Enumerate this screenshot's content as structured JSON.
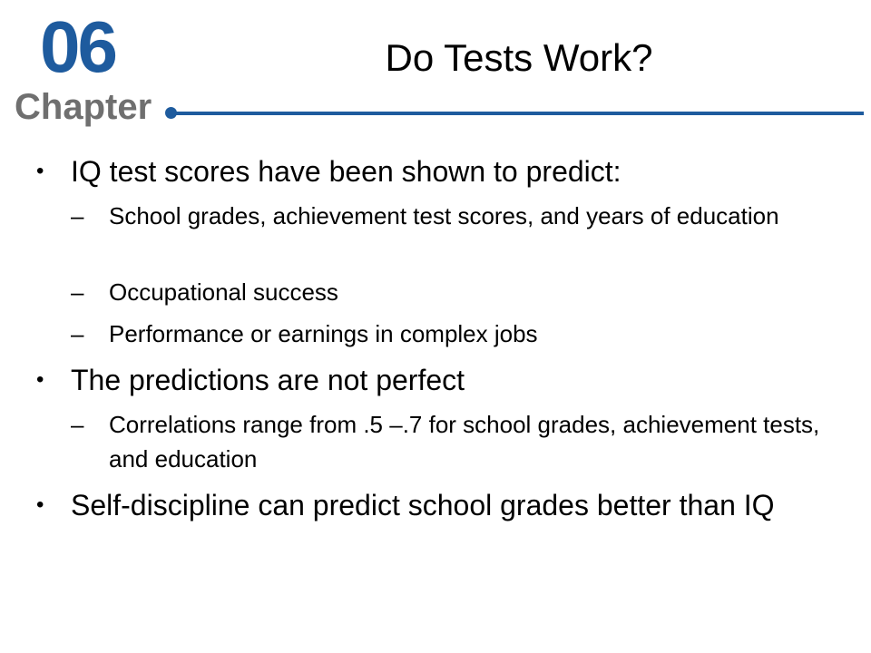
{
  "header": {
    "chapter_number": "06",
    "chapter_label": "Chapter",
    "title": "Do Tests Work?"
  },
  "colors": {
    "accent": "#1e5b9e",
    "chapter_label": "#6f6f6f"
  },
  "bullet_marker": "•",
  "sub_marker": "–",
  "bullets": [
    {
      "text": "IQ test scores have been shown to predict:",
      "subs": [
        "School grades, achievement test scores, and years of education",
        "Occupational success",
        "Performance or earnings in complex jobs"
      ]
    },
    {
      "text": "The predictions are not perfect",
      "subs": [
        "Correlations range from .5 –.7 for school grades, achievement tests, and education"
      ]
    },
    {
      "text": "Self-discipline can predict school grades better than IQ",
      "subs": []
    }
  ]
}
